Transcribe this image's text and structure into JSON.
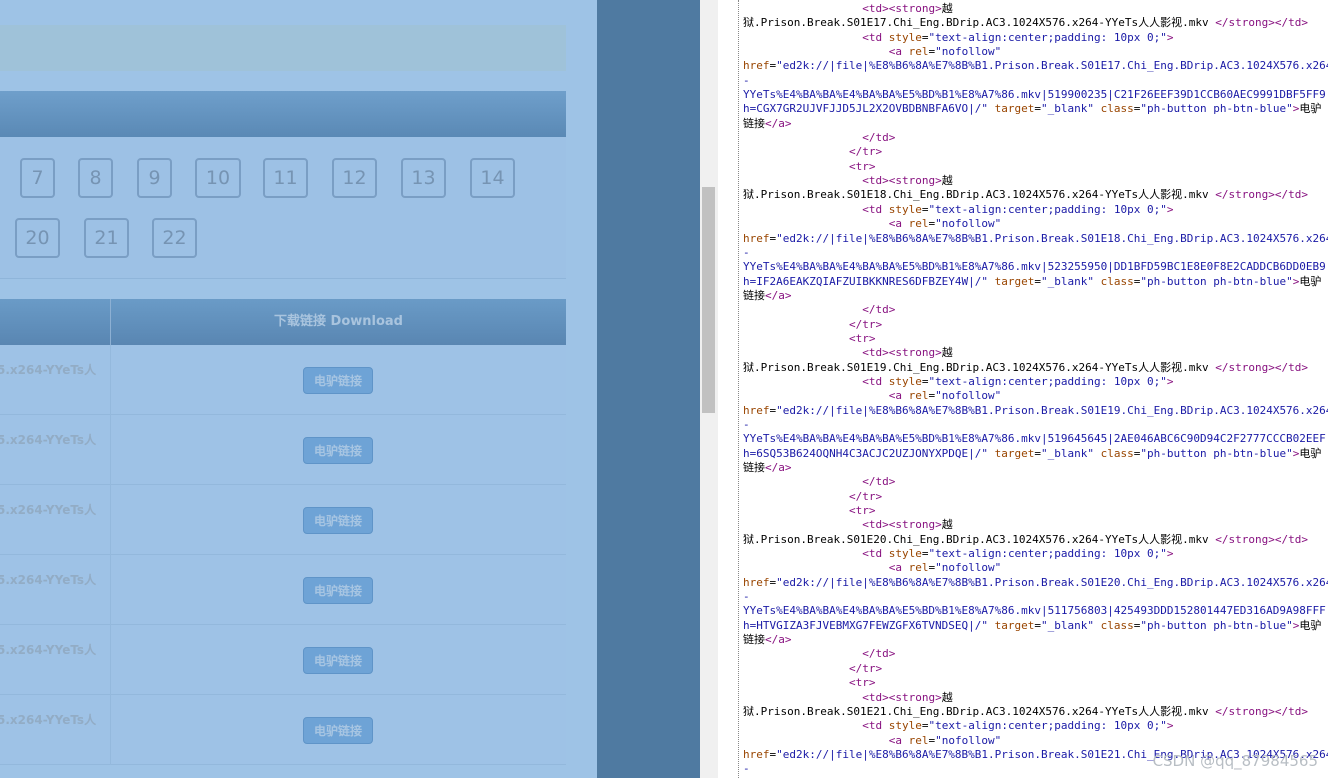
{
  "episodes": {
    "row1": [
      "7",
      "8",
      "9",
      "10",
      "11",
      "12",
      "13",
      "14"
    ],
    "row2": [
      "20",
      "21",
      "22"
    ]
  },
  "table": {
    "header_download": "下载链接 Download",
    "row_name_fragment": "5.x264-YYeTs人",
    "button_label": "电驴链接",
    "row_count": 6
  },
  "source_lines": [
    "                  <td><strong>越",
    "狱.Prison.Break.S01E17.Chi_Eng.BDrip.AC3.1024X576.x264-YYeTs人人影视.mkv </strong></td>",
    "                  <td style=\"text-align:center;padding: 10px 0;\">",
    "                      <a rel=\"nofollow\"",
    "href=\"ed2k://|file|%E8%B6%8A%E7%8B%B1.Prison.Break.S01E17.Chi_Eng.BDrip.AC3.1024X576.x264",
    "-",
    "YYeTs%E4%BA%BA%E4%BA%BA%E5%BD%B1%E8%A7%86.mkv|519900235|C21F26EEF39D1CCB60AEC9991DBF5FF9|",
    "h=CGX7GR2UJVFJJD5JL2X2OVBDBNBFA6VO|/\" target=\"_blank\" class=\"ph-button ph-btn-blue\">电驴",
    "链接</a>",
    "                  </td>",
    "                </tr>",
    "                <tr>",
    "                  <td><strong>越",
    "狱.Prison.Break.S01E18.Chi_Eng.BDrip.AC3.1024X576.x264-YYeTs人人影视.mkv </strong></td>",
    "                  <td style=\"text-align:center;padding: 10px 0;\">",
    "                      <a rel=\"nofollow\"",
    "href=\"ed2k://|file|%E8%B6%8A%E7%8B%B1.Prison.Break.S01E18.Chi_Eng.BDrip.AC3.1024X576.x264",
    "-",
    "YYeTs%E4%BA%BA%E4%BA%BA%E5%BD%B1%E8%A7%86.mkv|523255950|DD1BFD59BC1E8E0F8E2CADDCB6DD0EB9|",
    "h=IF2A6EAKZQIAFZUIBKKNRES6DFBZEY4W|/\" target=\"_blank\" class=\"ph-button ph-btn-blue\">电驴",
    "链接</a>",
    "                  </td>",
    "                </tr>",
    "                <tr>",
    "                  <td><strong>越",
    "狱.Prison.Break.S01E19.Chi_Eng.BDrip.AC3.1024X576.x264-YYeTs人人影视.mkv </strong></td>",
    "                  <td style=\"text-align:center;padding: 10px 0;\">",
    "                      <a rel=\"nofollow\"",
    "href=\"ed2k://|file|%E8%B6%8A%E7%8B%B1.Prison.Break.S01E19.Chi_Eng.BDrip.AC3.1024X576.x264",
    "-",
    "YYeTs%E4%BA%BA%E4%BA%BA%E5%BD%B1%E8%A7%86.mkv|519645645|2AE046ABC6C90D94C2F2777CCCB02EEF|",
    "h=6SQ53B624OQNH4C3ACJC2UZJONYXPDQE|/\" target=\"_blank\" class=\"ph-button ph-btn-blue\">电驴",
    "链接</a>",
    "                  </td>",
    "                </tr>",
    "                <tr>",
    "                  <td><strong>越",
    "狱.Prison.Break.S01E20.Chi_Eng.BDrip.AC3.1024X576.x264-YYeTs人人影视.mkv </strong></td>",
    "                  <td style=\"text-align:center;padding: 10px 0;\">",
    "                      <a rel=\"nofollow\"",
    "href=\"ed2k://|file|%E8%B6%8A%E7%8B%B1.Prison.Break.S01E20.Chi_Eng.BDrip.AC3.1024X576.x264",
    "-",
    "YYeTs%E4%BA%BA%E4%BA%BA%E5%BD%B1%E8%A7%86.mkv|511756803|425493DDD152801447ED316AD9A98FFF|",
    "h=HTVGIZA3FJVEBMXG7FEWZGFX6TVNDSEQ|/\" target=\"_blank\" class=\"ph-button ph-btn-blue\">电驴",
    "链接</a>",
    "                  </td>",
    "                </tr>",
    "                <tr>",
    "                  <td><strong>越",
    "狱.Prison.Break.S01E21.Chi_Eng.BDrip.AC3.1024X576.x264-YYeTs人人影视.mkv </strong></td>",
    "                  <td style=\"text-align:center;padding: 10px 0;\">",
    "                      <a rel=\"nofollow\"",
    "href=\"ed2k://|file|%E8%B6%8A%E7%8B%B1.Prison.Break.S01E21.Chi_Eng.BDrip.AC3.1024X576.x264",
    "-"
  ],
  "watermark": "CSDN @qq_87984565",
  "colors": {
    "page_bg": "#9ec3e6",
    "overlay_strip": "#4f7aa1",
    "tag_color": "#881280",
    "attr_color": "#994500",
    "value_color": "#1a1aa6"
  }
}
